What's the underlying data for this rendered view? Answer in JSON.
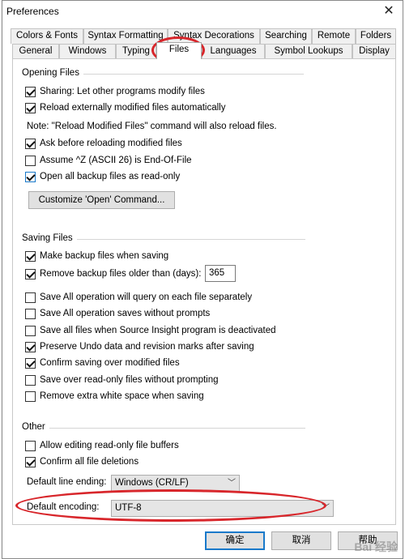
{
  "window": {
    "title": "Preferences"
  },
  "tabs_row1": [
    {
      "label": "Colors & Fonts"
    },
    {
      "label": "Syntax Formatting"
    },
    {
      "label": "Syntax Decorations"
    },
    {
      "label": "Searching"
    },
    {
      "label": "Remote"
    },
    {
      "label": "Folders"
    }
  ],
  "tabs_row2": [
    {
      "label": "General"
    },
    {
      "label": "Windows"
    },
    {
      "label": "Typing"
    },
    {
      "label": "Files",
      "active": true
    },
    {
      "label": "Languages"
    },
    {
      "label": "Symbol Lookups"
    },
    {
      "label": "Display"
    }
  ],
  "opening": {
    "title": "Opening Files",
    "sharing": {
      "label": "Sharing: Let other programs modify files",
      "checked": true
    },
    "reload": {
      "label": "Reload externally modified files automatically",
      "checked": true
    },
    "note": "Note: \"Reload Modified Files\" command will also reload files.",
    "ask": {
      "label": "Ask before reloading modified files",
      "checked": true
    },
    "assume": {
      "label": "Assume ^Z (ASCII 26) is End-Of-File",
      "checked": false
    },
    "open_backup": {
      "label": "Open all backup files as read-only",
      "checked": true
    },
    "customize_button": "Customize 'Open' Command..."
  },
  "saving": {
    "title": "Saving Files",
    "make_backup": {
      "label": "Make backup files when saving",
      "checked": true
    },
    "remove_backup": {
      "label": "Remove backup files older than (days):",
      "checked": true,
      "days": "365"
    },
    "save_all_query": {
      "label": "Save All operation will query on each file separately",
      "checked": false
    },
    "save_all_no_prompt": {
      "label": "Save All operation saves without prompts",
      "checked": false
    },
    "save_deactivated": {
      "label": "Save all files when Source Insight program is deactivated",
      "checked": false
    },
    "preserve_undo": {
      "label": "Preserve Undo data and revision marks after saving",
      "checked": true
    },
    "confirm_saving": {
      "label": "Confirm saving over modified files",
      "checked": true
    },
    "save_readonly": {
      "label": "Save over read-only files without prompting",
      "checked": false
    },
    "remove_whitespace": {
      "label": "Remove extra white space when saving",
      "checked": false
    }
  },
  "other": {
    "title": "Other",
    "allow_edit_readonly": {
      "label": "Allow editing read-only file buffers",
      "checked": false
    },
    "confirm_deletions": {
      "label": "Confirm all file deletions",
      "checked": true
    },
    "line_ending_label": "Default line ending:",
    "line_ending_value": "Windows (CR/LF)",
    "encoding_label": "Default encoding:",
    "encoding_value": "UTF-8"
  },
  "footer": {
    "ok": "确定",
    "cancel": "取消",
    "help": "帮助"
  },
  "watermark": "Bai 经验"
}
